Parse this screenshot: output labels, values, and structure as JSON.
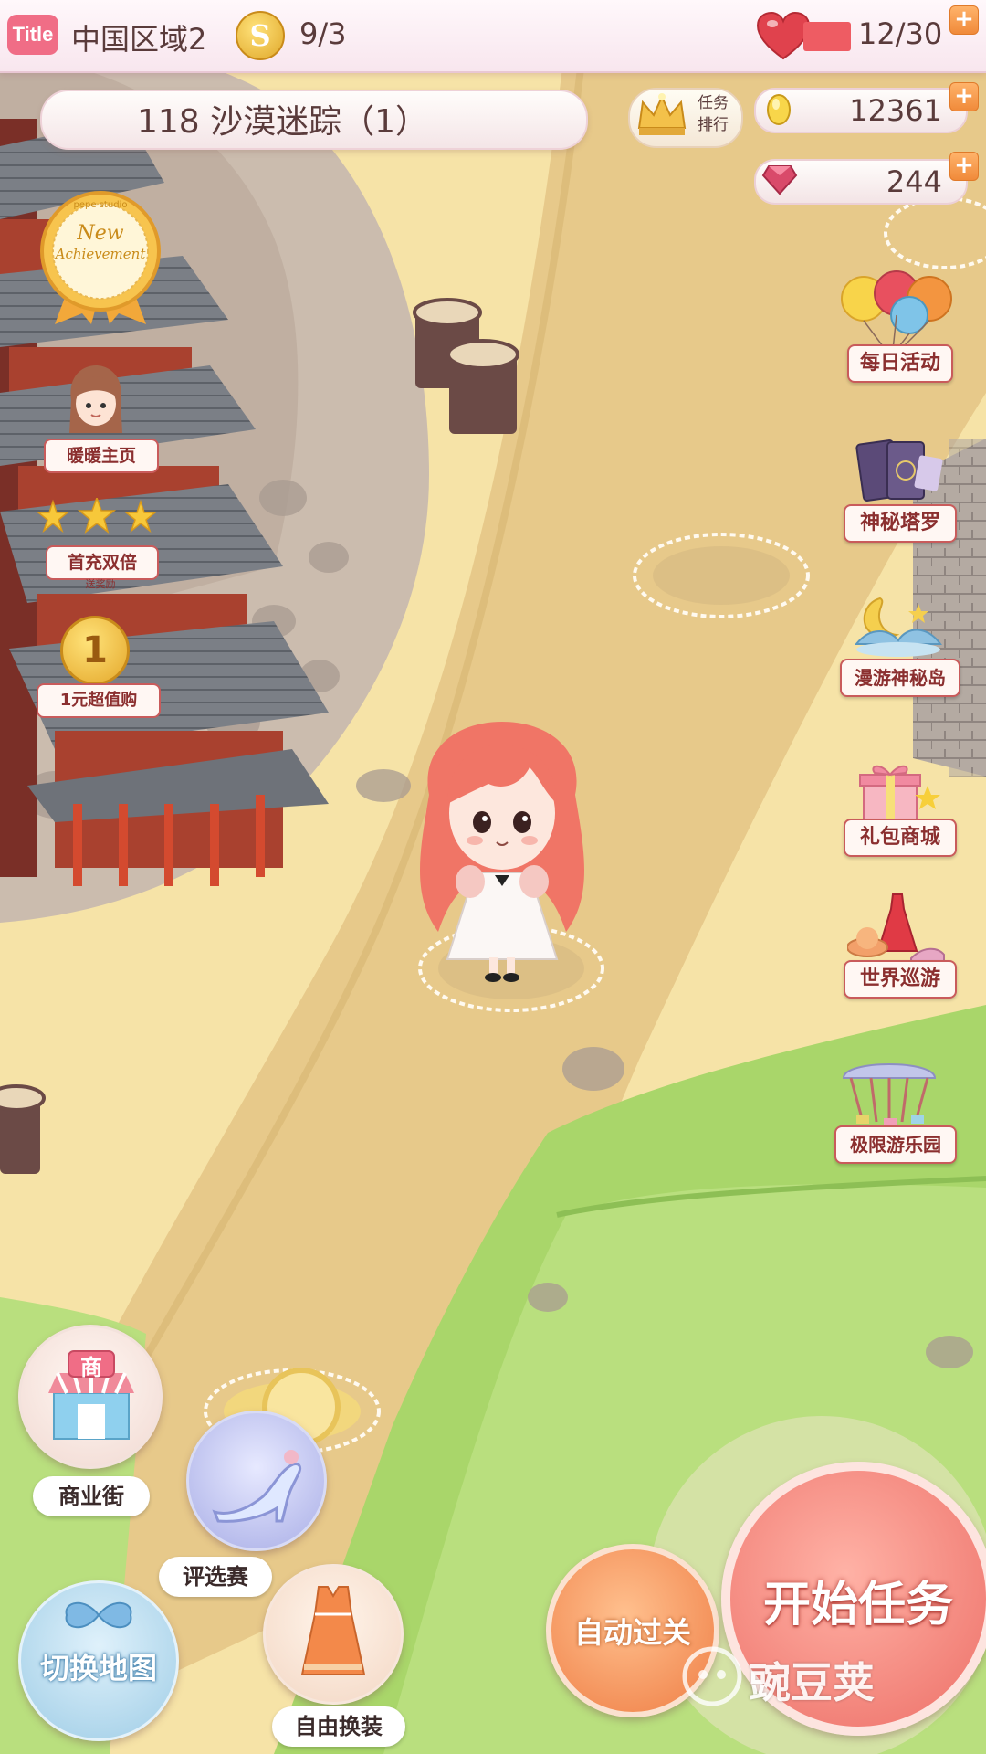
{
  "header": {
    "title_badge": "Title",
    "server_name": "中国区域2",
    "coin_symbol": "S",
    "stamina": "9/3",
    "hearts": "12/30",
    "plus_symbol": "+"
  },
  "level": {
    "name": "118 沙漠迷踪（1）",
    "ranking_label_line1": "任务",
    "ranking_label_line2": "排行"
  },
  "resources": {
    "gold": "12361",
    "diamonds": "244"
  },
  "achievement_badge": {
    "line1": "New",
    "line2": "Achievement",
    "arc_text": "pepe studio"
  },
  "left_menu": [
    {
      "label": "暖暖主页"
    },
    {
      "label": "首充双倍",
      "sub": "送奖励"
    },
    {
      "label": "1元超值购",
      "badge": "1"
    }
  ],
  "right_menu": [
    {
      "label": "每日活动",
      "icon": "balloons-icon"
    },
    {
      "label": "神秘塔罗",
      "icon": "tarot-cards-icon"
    },
    {
      "label": "漫游神秘岛",
      "icon": "moon-island-icon"
    },
    {
      "label": "礼包商城",
      "icon": "gift-box-icon"
    },
    {
      "label": "世界巡游",
      "icon": "dress-hat-shoes-icon"
    },
    {
      "label": "极限游乐园",
      "icon": "carousel-icon"
    }
  ],
  "bottom_menu": {
    "shop_glyph": "商",
    "shop_label": "商业街",
    "contest_label": "评选赛",
    "switch_map_label": "切换地图",
    "dress_up_label": "自由换装",
    "auto_pass_label": "自动过关",
    "start_task_label": "开始任务"
  },
  "watermark": "豌豆荚",
  "colors": {
    "accent_pink": "#f06d86",
    "label_border": "#c95b5b",
    "sand": "#f6e3a7",
    "path": "#e7c98a",
    "grass": "#a9d66a"
  }
}
